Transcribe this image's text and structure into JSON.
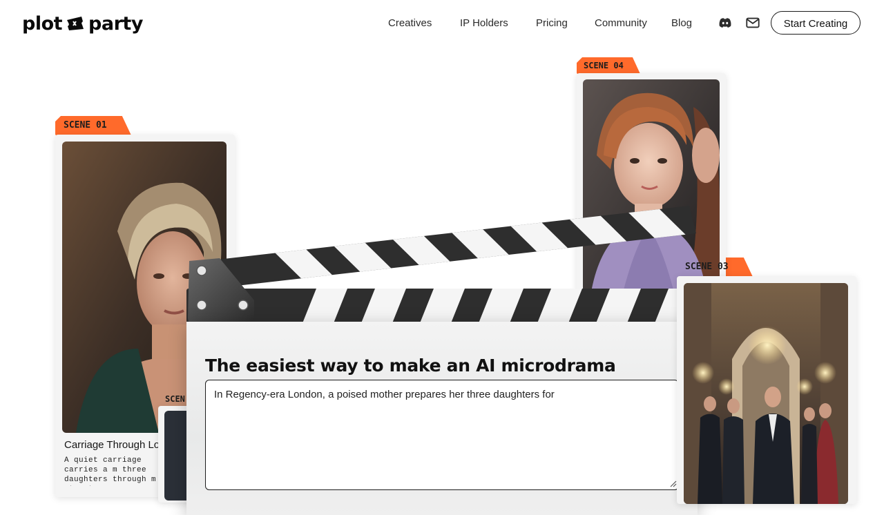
{
  "brand": {
    "logo_left": "plot",
    "logo_right": "party"
  },
  "nav": {
    "links": [
      {
        "label": "Creatives"
      },
      {
        "label": "IP Holders"
      },
      {
        "label": "Pricing"
      },
      {
        "label": "Community"
      },
      {
        "label": "Blog"
      }
    ],
    "icons": [
      "discord-icon",
      "mail-icon"
    ],
    "cta_label": "Start Creating"
  },
  "scenes": [
    {
      "tag": "SCENE 01",
      "title": "Carriage Through Lon",
      "description": "A quiet carriage carries a m three daughters through m streets."
    },
    {
      "tag": "SCEN"
    },
    {
      "tag": "SCENE 04"
    },
    {
      "tag": "SCENE 03"
    }
  ],
  "hero": {
    "headline": "The easiest way to make an AI microdrama",
    "prompt_value": "In Regency-era London, a poised mother prepares her three daughters for"
  },
  "colors": {
    "accent": "#ff6a2b",
    "text": "#111111",
    "background": "#ffffff"
  }
}
